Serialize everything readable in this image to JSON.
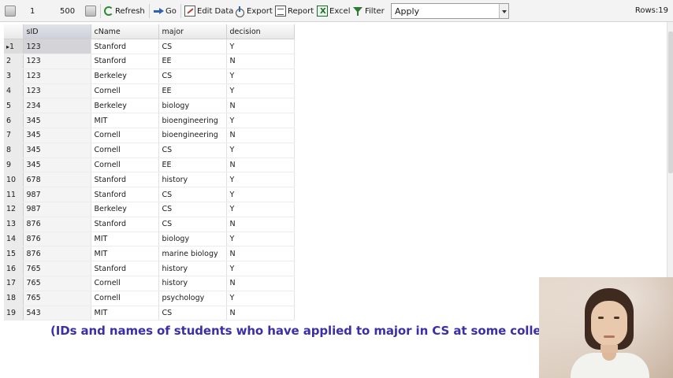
{
  "toolbar": {
    "range_start": "1",
    "range_end": "500",
    "refresh_label": "Refresh",
    "go_label": "Go",
    "edit_data_label": "Edit Data",
    "export_label": "Export",
    "report_label": "Report",
    "excel_label": "Excel",
    "filter_label": "Filter",
    "filter_value": "Apply",
    "rows_count": "Rows:19"
  },
  "grid": {
    "columns": [
      "sID",
      "cName",
      "major",
      "decision"
    ],
    "rows": [
      {
        "rn": "1",
        "sid": "123",
        "cname": "Stanford",
        "major": "CS",
        "decision": "Y"
      },
      {
        "rn": "2",
        "sid": "123",
        "cname": "Stanford",
        "major": "EE",
        "decision": "N"
      },
      {
        "rn": "3",
        "sid": "123",
        "cname": "Berkeley",
        "major": "CS",
        "decision": "Y"
      },
      {
        "rn": "4",
        "sid": "123",
        "cname": "Cornell",
        "major": "EE",
        "decision": "Y"
      },
      {
        "rn": "5",
        "sid": "234",
        "cname": "Berkeley",
        "major": "biology",
        "decision": "N"
      },
      {
        "rn": "6",
        "sid": "345",
        "cname": "MIT",
        "major": "bioengineering",
        "decision": "Y"
      },
      {
        "rn": "7",
        "sid": "345",
        "cname": "Cornell",
        "major": "bioengineering",
        "decision": "N"
      },
      {
        "rn": "8",
        "sid": "345",
        "cname": "Cornell",
        "major": "CS",
        "decision": "Y"
      },
      {
        "rn": "9",
        "sid": "345",
        "cname": "Cornell",
        "major": "EE",
        "decision": "N"
      },
      {
        "rn": "10",
        "sid": "678",
        "cname": "Stanford",
        "major": "history",
        "decision": "Y"
      },
      {
        "rn": "11",
        "sid": "987",
        "cname": "Stanford",
        "major": "CS",
        "decision": "Y"
      },
      {
        "rn": "12",
        "sid": "987",
        "cname": "Berkeley",
        "major": "CS",
        "decision": "Y"
      },
      {
        "rn": "13",
        "sid": "876",
        "cname": "Stanford",
        "major": "CS",
        "decision": "N"
      },
      {
        "rn": "14",
        "sid": "876",
        "cname": "MIT",
        "major": "biology",
        "decision": "Y"
      },
      {
        "rn": "15",
        "sid": "876",
        "cname": "MIT",
        "major": "marine biology",
        "decision": "N"
      },
      {
        "rn": "16",
        "sid": "765",
        "cname": "Stanford",
        "major": "history",
        "decision": "Y"
      },
      {
        "rn": "17",
        "sid": "765",
        "cname": "Cornell",
        "major": "history",
        "decision": "N"
      },
      {
        "rn": "18",
        "sid": "765",
        "cname": "Cornell",
        "major": "psychology",
        "decision": "Y"
      },
      {
        "rn": "19",
        "sid": "543",
        "cname": "MIT",
        "major": "CS",
        "decision": "N"
      }
    ],
    "selected_row_marker": "▸"
  },
  "caption": "(IDs and names of students who have applied to major in CS at some college)",
  "colors": {
    "caption": "#3b2fa8",
    "toolbar_bg": "#f3f3f3",
    "header_bg": "#e9e9e9"
  }
}
